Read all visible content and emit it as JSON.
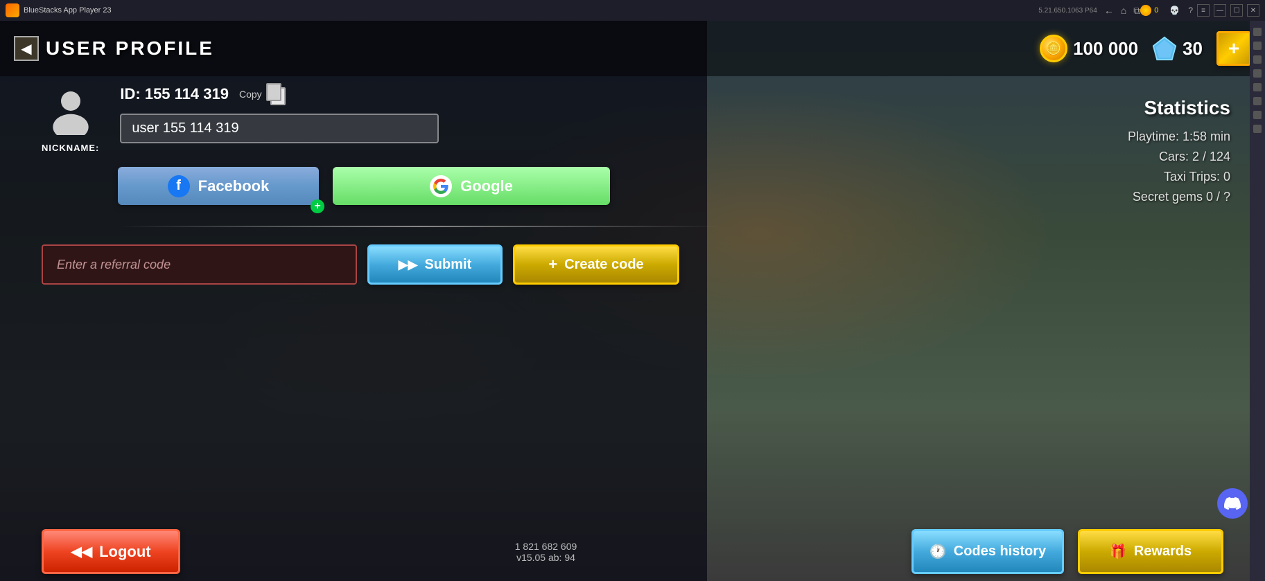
{
  "titlebar": {
    "app_name": "BlueStacks App Player 23",
    "version": "5.21.650.1063  P64",
    "coin_count": "0"
  },
  "header": {
    "back_label": "◀",
    "title": "USER PROFILE",
    "coins": "100 000",
    "gems": "30",
    "add_label": "+"
  },
  "profile": {
    "id_label": "ID: 155 114 319",
    "copy_label": "Copy",
    "nickname_value": "user 155 114 319",
    "nickname_placeholder": "user 155 114 319",
    "nickname_prefix": "NICKNAME:"
  },
  "social": {
    "facebook_label": "Facebook",
    "google_label": "Google"
  },
  "referral": {
    "input_placeholder": "Enter a referral code",
    "submit_label": "Submit",
    "create_code_label": "Create code"
  },
  "statistics": {
    "title": "Statistics",
    "playtime_label": "Playtime: 1:58 min",
    "cars_label": "Cars: 2 / 124",
    "taxi_trips_label": "Taxi Trips: 0",
    "secret_gems_label": "Secret gems 0 / ?"
  },
  "bottom": {
    "logout_label": "Logout",
    "version_line1": "1 821 682 609",
    "version_line2": "v15.05 ab: 94",
    "codes_history_label": "Codes history",
    "rewards_label": "Rewards"
  }
}
